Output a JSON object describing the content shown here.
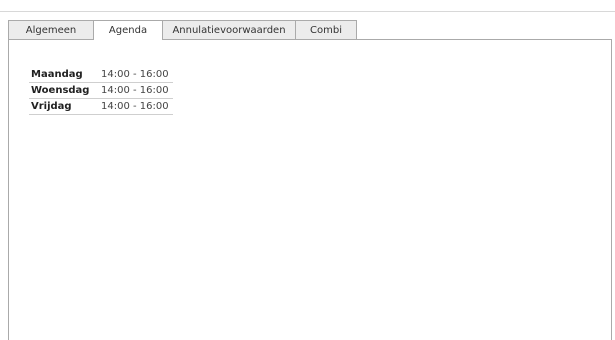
{
  "tabs": [
    {
      "label": "Algemeen",
      "active": false
    },
    {
      "label": "Agenda",
      "active": true
    },
    {
      "label": "Annulatievoorwaarden",
      "active": false
    },
    {
      "label": "Combi",
      "active": false
    }
  ],
  "agenda": {
    "rows": [
      {
        "day": "Maandag",
        "time": "14:00 - 16:00"
      },
      {
        "day": "Woensdag",
        "time": "14:00 - 16:00"
      },
      {
        "day": "Vrijdag",
        "time": "14:00 - 16:00"
      }
    ]
  },
  "colors": {
    "border": "#aaaaaa",
    "inactive_tab_bg": "#ececec",
    "active_tab_bg": "#ffffff",
    "row_divider": "#cfcfcf"
  }
}
